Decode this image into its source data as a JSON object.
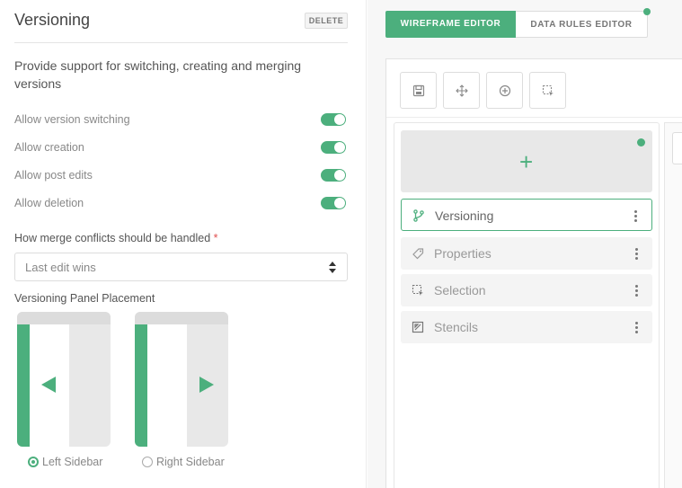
{
  "settings": {
    "title": "Versioning",
    "delete_label": "DELETE",
    "description": "Provide support for switching, creating and merging versions",
    "toggles": [
      {
        "label": "Allow version switching",
        "on": true
      },
      {
        "label": "Allow creation",
        "on": true
      },
      {
        "label": "Allow post edits",
        "on": true
      },
      {
        "label": "Allow deletion",
        "on": true
      }
    ],
    "merge_label": "How merge conflicts should be handled",
    "merge_required_mark": "*",
    "merge_value": "Last edit wins",
    "placement_label": "Versioning Panel Placement",
    "placement_options": [
      {
        "label": "Left Sidebar",
        "selected": true
      },
      {
        "label": "Right Sidebar",
        "selected": false
      }
    ]
  },
  "editor": {
    "tabs": [
      {
        "label": "WIREFRAME EDITOR",
        "active": true
      },
      {
        "label": "DATA RULES EDITOR",
        "active": false
      }
    ],
    "toolbar": [
      "save-icon",
      "move-icon",
      "add-circle-icon",
      "select-icon"
    ],
    "add_symbol": "+",
    "items": [
      {
        "label": "Versioning",
        "icon": "branch-icon",
        "active": true
      },
      {
        "label": "Properties",
        "icon": "tag-icon",
        "active": false
      },
      {
        "label": "Selection",
        "icon": "selection-icon",
        "active": false
      },
      {
        "label": "Stencils",
        "icon": "stencil-icon",
        "active": false
      }
    ]
  },
  "colors": {
    "accent": "#4caf7d",
    "required": "#e05050"
  }
}
